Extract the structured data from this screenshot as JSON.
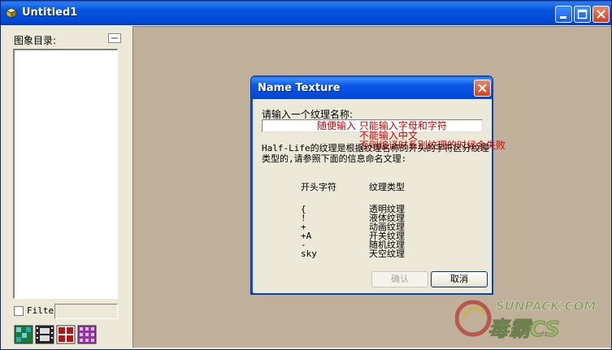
{
  "window": {
    "title": "Untitled1"
  },
  "left_panel": {
    "label": "图象目录:",
    "filter_label": "Filte",
    "filter_value": ""
  },
  "dialog": {
    "title": "Name Texture",
    "prompt": "请输入一个纹理名称:",
    "input_value": "",
    "annotations": [
      "随便输入 只能输入字母和字符",
      "不能输入中文",
      "否则编译时系别纹理的时候会失败"
    ],
    "description": "Half-Life的纹理是根据纹理名称的开头的字符区分纹理类型的,请参照下面的信息命名文理:",
    "table": {
      "headers": [
        "开头字符",
        "纹理类型"
      ],
      "rows": [
        {
          "prefix": "{",
          "type": "透明纹理"
        },
        {
          "prefix": "!",
          "type": "液体纹理"
        },
        {
          "prefix": "+",
          "type": "动画纹理"
        },
        {
          "prefix": "+A",
          "type": "开关纹理"
        },
        {
          "prefix": "-",
          "type": "随机纹理"
        },
        {
          "prefix": "sky",
          "type": "天空纹理"
        }
      ]
    },
    "ok_label": "确认",
    "cancel_label": "取消"
  },
  "watermark": {
    "top": "SUNPACK.COM",
    "bottom": "毒霸CS"
  },
  "colors": {
    "titlebar": "#0454e0",
    "workspace": "#c0b09a",
    "annotation": "#d00000"
  }
}
